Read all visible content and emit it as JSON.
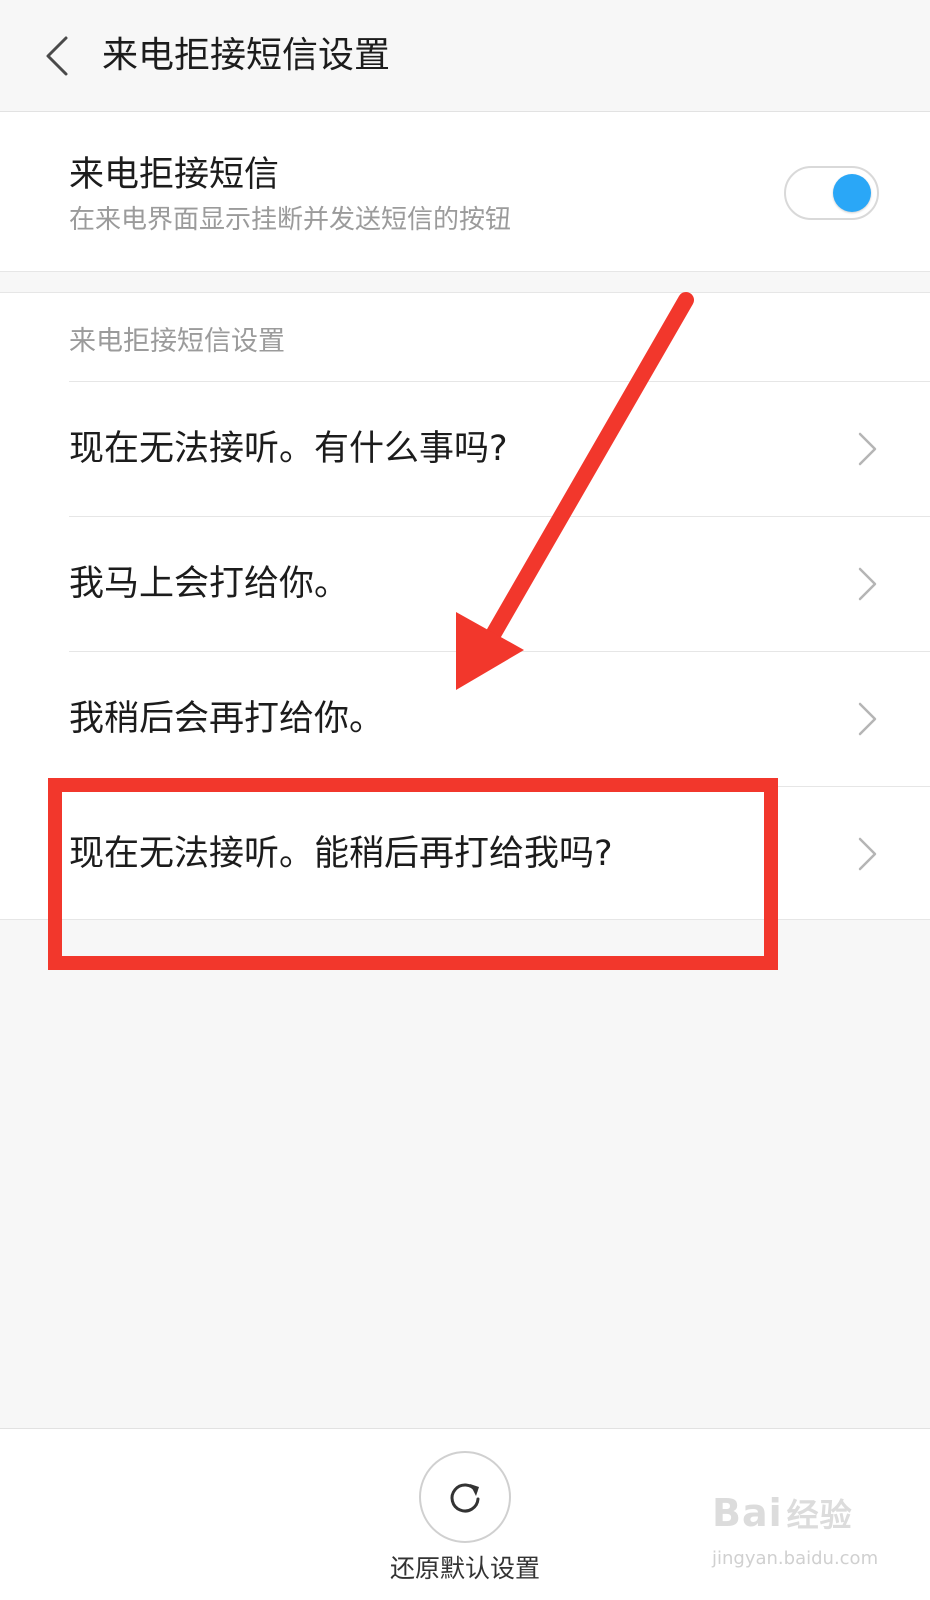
{
  "header": {
    "title": "来电拒接短信设置"
  },
  "toggle": {
    "title": "来电拒接短信",
    "subtitle": "在来电界面显示挂断并发送短信的按钮",
    "enabled": true
  },
  "messages": {
    "section_header": "来电拒接短信设置",
    "items": [
      {
        "text": "现在无法接听。有什么事吗?"
      },
      {
        "text": "我马上会打给你。"
      },
      {
        "text": "我稍后会再打给你。"
      },
      {
        "text": "现在无法接听。能稍后再打给我吗?"
      }
    ]
  },
  "bottom": {
    "reset_label": "还原默认设置"
  },
  "watermark": {
    "brand": "Bai",
    "brand_cn": "经验",
    "url": "jingyan.baidu.com"
  },
  "colors": {
    "accent": "#2aa7f7",
    "annotation": "#f2372c"
  },
  "icons": {
    "back": "chevron-left-icon",
    "row": "chevron-right-icon",
    "reset": "refresh-icon"
  }
}
